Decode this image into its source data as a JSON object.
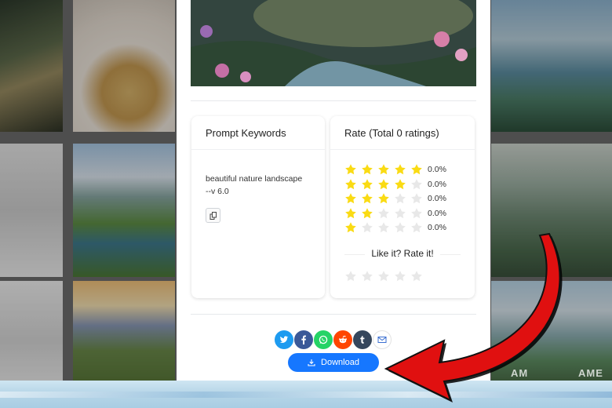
{
  "keywords_card": {
    "title": "Prompt Keywords",
    "text": "beautiful nature landscape\n--v 6.0",
    "copy_icon": "copy-icon"
  },
  "rating_card": {
    "title": "Rate (Total 0 ratings)",
    "rows": [
      {
        "stars": 5,
        "pct": "0.0%"
      },
      {
        "stars": 4,
        "pct": "0.0%"
      },
      {
        "stars": 3,
        "pct": "0.0%"
      },
      {
        "stars": 2,
        "pct": "0.0%"
      },
      {
        "stars": 1,
        "pct": "0.0%"
      }
    ],
    "prompt": "Like it? Rate it!",
    "user_rating": 0,
    "max_stars": 5
  },
  "share": {
    "icons": [
      "twitter-icon",
      "facebook-icon",
      "whatsapp-icon",
      "reddit-icon",
      "tumblr-icon",
      "email-icon"
    ]
  },
  "download": {
    "label": "Download",
    "icon": "download-icon"
  },
  "watermarks": [
    "AM",
    "AME"
  ],
  "colors": {
    "star_filled": "#fadb14",
    "star_empty": "#e8e8e8",
    "download_bg": "#1677ff",
    "twitter": "#1d9bf0",
    "facebook": "#3b5998",
    "whatsapp": "#25d366",
    "reddit": "#ff4500",
    "tumblr": "#35465c",
    "arrow": "#e01010"
  }
}
